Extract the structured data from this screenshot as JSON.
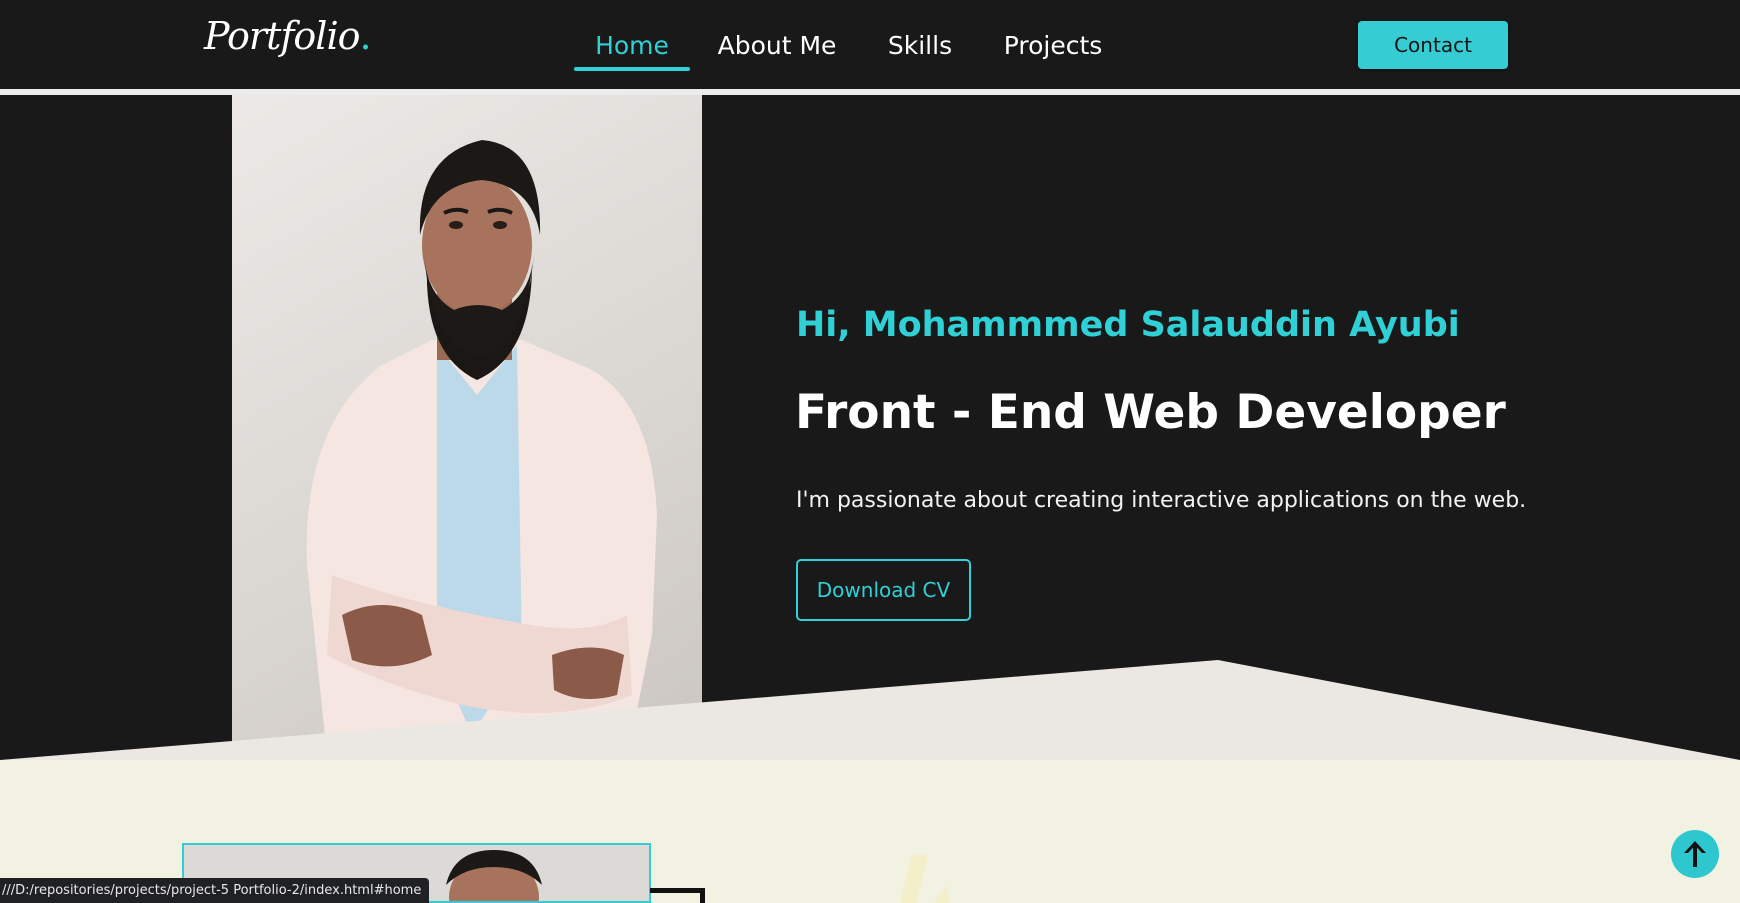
{
  "nav": {
    "logo": "Portfolio",
    "logo_dot": ".",
    "links": [
      {
        "label": "Home",
        "active": true
      },
      {
        "label": "About Me",
        "active": false
      },
      {
        "label": "Skills",
        "active": false
      },
      {
        "label": "Projects",
        "active": false
      }
    ],
    "contact_label": "Contact"
  },
  "hero": {
    "greeting": "Hi, Mohammmed Salauddin Ayubi",
    "role": "Front - End Web Developer",
    "tagline": "I'm passionate about creating interactive applications on the web.",
    "cv_button": "Download CV",
    "photo_icon": "profile-photo"
  },
  "scroll_top_icon": "arrow-up-icon",
  "status_url": "///D:/repositories/projects/project-5 Portfolio-2/index.html#home",
  "colors": {
    "accent": "#2fd0d6",
    "background": "#191919",
    "section_bg": "#f1f2e2",
    "text": "#ffffff"
  }
}
